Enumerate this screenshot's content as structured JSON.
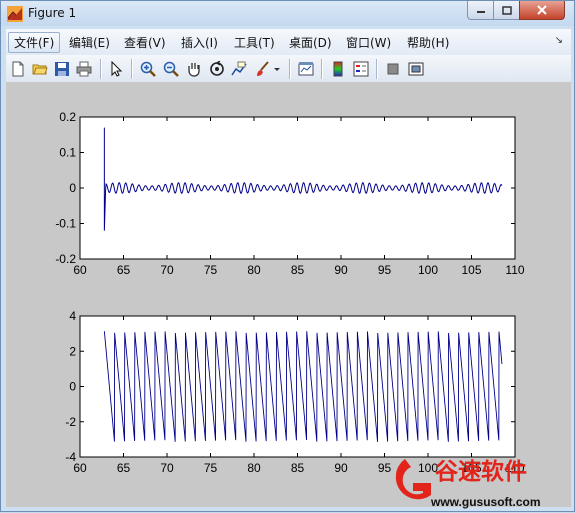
{
  "window": {
    "title": "Figure 1"
  },
  "menu": {
    "items": [
      {
        "label": "文件(F)"
      },
      {
        "label": "编辑(E)"
      },
      {
        "label": "查看(V)"
      },
      {
        "label": "插入(I)"
      },
      {
        "label": "工具(T)"
      },
      {
        "label": "桌面(D)"
      },
      {
        "label": "窗口(W)"
      },
      {
        "label": "帮助(H)"
      }
    ],
    "overflow_glyph": "↘"
  },
  "toolbar": {
    "icons": [
      "new-file-icon",
      "open-folder-icon",
      "save-icon",
      "print-icon",
      "pointer-icon",
      "zoom-in-icon",
      "zoom-out-icon",
      "pan-hand-icon",
      "rotate-3d-icon",
      "data-cursor-icon",
      "brush-icon",
      "link-plot-icon",
      "colorbar-icon",
      "legend-icon",
      "hide-plot-tools-icon",
      "show-plot-tools-icon"
    ]
  },
  "chart_data": [
    {
      "type": "line",
      "x_range": [
        60,
        110
      ],
      "ylim": [
        -0.2,
        0.2
      ],
      "xticks": [
        "60",
        "65",
        "70",
        "75",
        "80",
        "85",
        "90",
        "95",
        "100",
        "105",
        "110"
      ],
      "yticks": [
        "0.2",
        "0.1",
        "0",
        "-0.1",
        "-0.2"
      ],
      "series": [
        {
          "color": "#00008b",
          "x_start": 62.8,
          "x_end": 108.5,
          "spike": [
            0.17,
            -0.12
          ],
          "oscillation_amplitude": 0.015
        }
      ],
      "grid": false
    },
    {
      "type": "line",
      "x_range": [
        60,
        110
      ],
      "ylim": [
        -4,
        4
      ],
      "xticks": [
        "60",
        "65",
        "70",
        "75",
        "80",
        "85",
        "90",
        "95",
        "100",
        "105",
        "110"
      ],
      "yticks": [
        "4",
        "2",
        "0",
        "-2",
        "-4"
      ],
      "series": [
        {
          "color": "#00008b",
          "x_start": 62.8,
          "x_end": 108.5,
          "wrapped_phase_range": [
            -3.14,
            3.14
          ]
        }
      ],
      "grid": false
    }
  ],
  "watermark": {
    "name": "谷速软件",
    "url": "www.gususoft.com",
    "color": "#e2241a"
  }
}
